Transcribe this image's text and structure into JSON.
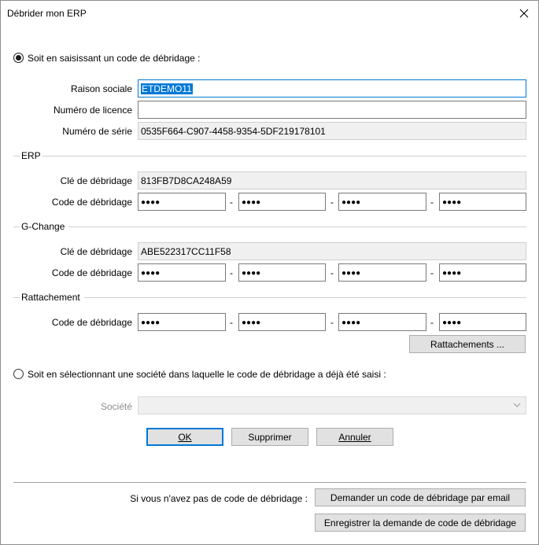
{
  "window": {
    "title": "Débrider mon ERP"
  },
  "option1": {
    "label": "Soit en saisissant un code de débridage :",
    "raison_label": "Raison sociale",
    "raison_value": "ETDEMO11",
    "licence_label": "Numéro de licence",
    "licence_value": "",
    "serie_label": "Numéro de série",
    "serie_value": "0535F664-C907-4458-9354-5DF219178101"
  },
  "erp": {
    "title": "ERP",
    "cle_label": "Clé de débridage",
    "cle_value": "813FB7D8CA248A59",
    "code_label": "Code de débridage",
    "codes": [
      "●●●●",
      "●●●●",
      "●●●●",
      "●●●●"
    ]
  },
  "gchange": {
    "title": "G-Change",
    "cle_label": "Clé de débridage",
    "cle_value": "ABE522317CC11F58",
    "code_label": "Code de débridage",
    "codes": [
      "●●●●",
      "●●●●",
      "●●●●",
      "●●●●"
    ]
  },
  "rattachement": {
    "title": "Rattachement",
    "code_label": "Code de débridage",
    "codes": [
      "●●●●",
      "●●●●",
      "●●●●",
      "●●●●"
    ],
    "button": "Rattachements ..."
  },
  "separator": "-",
  "option2": {
    "label": "Soit en sélectionnant une société dans laquelle le code de débridage a déjà été saisi :",
    "societe_label": "Société",
    "societe_value": ""
  },
  "buttons": {
    "ok": "OK",
    "supprimer": "Supprimer",
    "annuler": "Annuler"
  },
  "footer": {
    "text": "Si vous n'avez pas de code de débridage :",
    "email_button": "Demander un code de débridage par email",
    "register_button": "Enregistrer la demande de code de débridage"
  },
  "icons": {
    "close": "close-icon",
    "dropdown": "chevron-down-icon"
  },
  "colors": {
    "accent": "#0078d7",
    "button_bg": "#e1e1e1",
    "readonly_bg": "#f0f0f0"
  }
}
